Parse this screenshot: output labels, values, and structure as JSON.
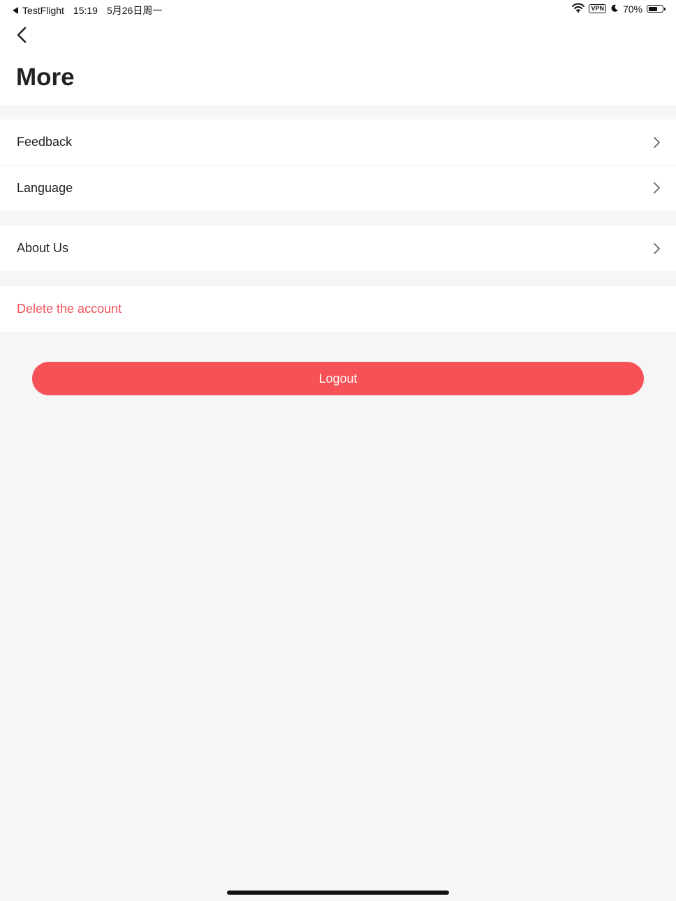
{
  "status_bar": {
    "back_app": "TestFlight",
    "time": "15:19",
    "date": "5月26日周一",
    "vpn": "VPN",
    "battery": "70%",
    "battery_level": 0.7
  },
  "header": {
    "title": "More"
  },
  "menu": {
    "group1": [
      {
        "label": "Feedback"
      },
      {
        "label": "Language"
      }
    ],
    "group2": [
      {
        "label": "About Us"
      }
    ],
    "delete_account": "Delete the account"
  },
  "logout_label": "Logout",
  "colors": {
    "accent": "#f65156",
    "danger_text": "#f0525a",
    "background": "#f6f6f6"
  },
  "icons": {
    "back": "chevron-left-icon",
    "row_arrow": "chevron-right-icon",
    "wifi": "wifi-icon",
    "moon": "moon-icon",
    "battery": "battery-icon"
  }
}
